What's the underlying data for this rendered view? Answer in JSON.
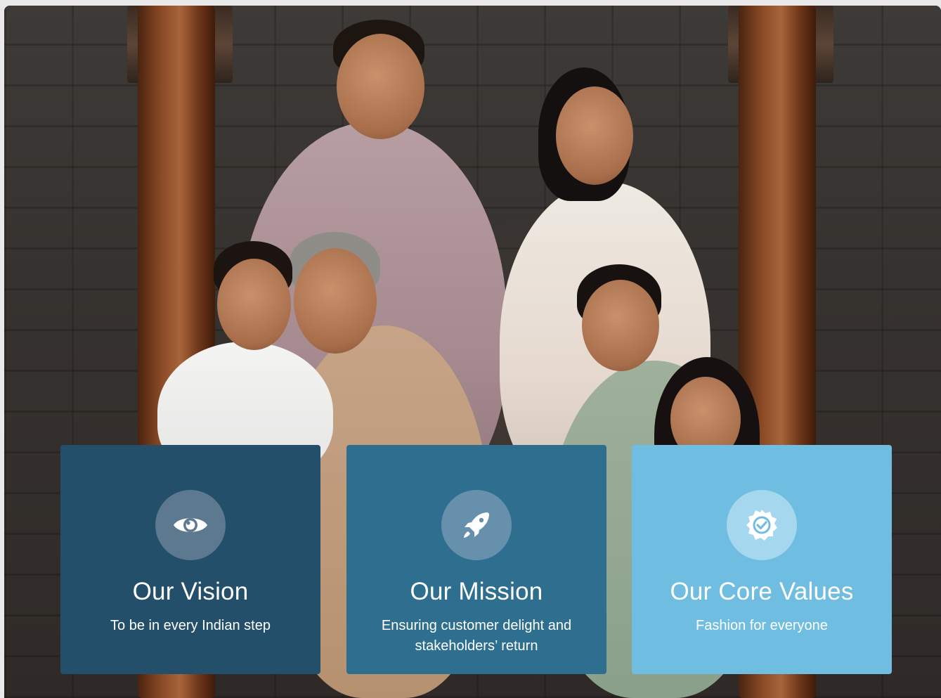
{
  "hero": {
    "image_alt": "Family portrait"
  },
  "cards": [
    {
      "title": "Our Vision",
      "text": "To be in every Indian step",
      "icon": "eye-icon",
      "color": "#234f6b"
    },
    {
      "title": "Our Mission",
      "text": "Ensuring customer delight and stakeholders’ return",
      "icon": "rocket-icon",
      "color": "#2e6e8f"
    },
    {
      "title": "Our Core Values",
      "text": "Fashion for everyone",
      "icon": "badge-check-icon",
      "color": "#6fbde0"
    }
  ]
}
